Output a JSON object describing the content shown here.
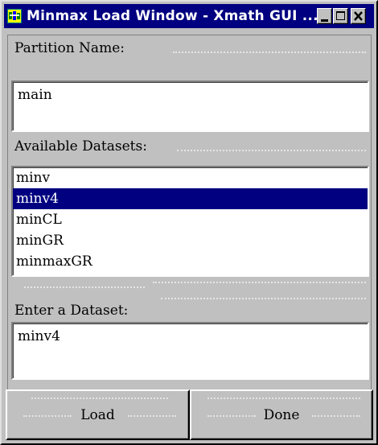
{
  "window": {
    "title": "Minmax Load Window - Xmath GUI ...",
    "icons": {
      "app": "xmath-app-icon",
      "minimize": "minimize-icon",
      "maximize": "maximize-icon",
      "close": "close-icon"
    }
  },
  "partition": {
    "label": "Partition Name:",
    "value": "main"
  },
  "datasets": {
    "label": "Available Datasets:",
    "items": [
      "minv",
      "minv4",
      "minCL",
      "minGR",
      "minmaxGR"
    ],
    "selected": "minv4"
  },
  "entry": {
    "label": "Enter a Dataset:",
    "value": "minv4"
  },
  "buttons": {
    "load": "Load",
    "done": "Done"
  },
  "colors": {
    "titlebar": "#000080",
    "selection": "#000080",
    "face": "#c0c0c0"
  }
}
